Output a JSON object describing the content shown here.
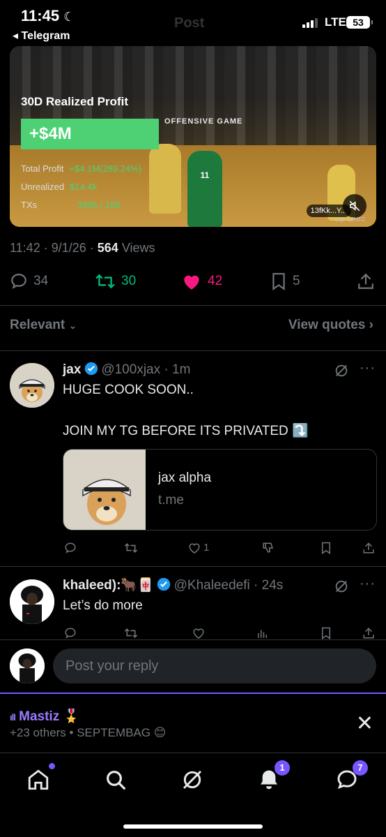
{
  "status_bar": {
    "time": "11:45",
    "back_app": "◂ Telegram",
    "ghost_title": "Post",
    "network": "LTE",
    "battery": "53"
  },
  "media": {
    "stat_title": "30D Realized Profit",
    "profit": "+$4M",
    "overlay_text": "OFFENSIVE GAME",
    "rows": [
      {
        "label": "Total Profit",
        "value": "+$4.1M(289.24%)"
      },
      {
        "label": "Unrealized",
        "value": "$14.4k"
      },
      {
        "label": "TXs",
        "value": "3986 / 168"
      }
    ],
    "player_number": "11",
    "handle": "13fKk...Y...",
    "watermark": "Clip: 1ZMFZ"
  },
  "post_meta": {
    "time": "11:42",
    "date": "9/1/26",
    "views_count": "564",
    "views_label": "Views"
  },
  "actions": {
    "replies": "34",
    "reposts": "30",
    "likes": "42",
    "bookmarks": "5"
  },
  "sort": {
    "relevant": "Relevant",
    "view_quotes": "View quotes"
  },
  "replies": [
    {
      "name": "jax",
      "handle": "@100xjax",
      "time": "1m",
      "text1": "HUGE COOK SOON..",
      "text2": "JOIN MY TG BEFORE ITS PRIVATED ⤵️",
      "card_title": "jax alpha",
      "card_domain": "t.me",
      "likes": "1"
    },
    {
      "name": "khaleed):🐂🀄",
      "handle": "@Khaleedefi",
      "time": "24s",
      "text1": "Let’s do more"
    }
  ],
  "reply_composer": {
    "placeholder": "Post your reply"
  },
  "live": {
    "name": "Mastiz 🎖️",
    "subtitle": "+23 others • SEPTEMBAG 😊"
  },
  "tabbar": {
    "notifications_badge": "1",
    "messages_badge": "7"
  },
  "colors": {
    "accent": "#7856ff",
    "like": "#f91880",
    "repost": "#00ba7c",
    "verified": "#1d9bf0"
  }
}
